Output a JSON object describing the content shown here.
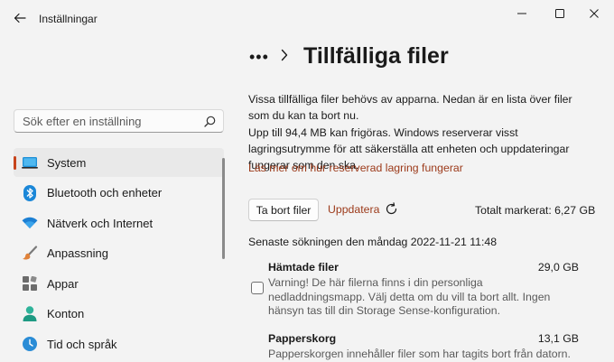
{
  "window": {
    "app_title": "Inställningar"
  },
  "search": {
    "placeholder": "Sök efter en inställning"
  },
  "sidebar": {
    "items": [
      {
        "label": "System",
        "icon": "laptop-icon",
        "active": true
      },
      {
        "label": "Bluetooth och enheter",
        "icon": "bluetooth-icon",
        "active": false
      },
      {
        "label": "Nätverk och Internet",
        "icon": "wifi-icon",
        "active": false
      },
      {
        "label": "Anpassning",
        "icon": "brush-icon",
        "active": false
      },
      {
        "label": "Appar",
        "icon": "apps-icon",
        "active": false
      },
      {
        "label": "Konton",
        "icon": "person-icon",
        "active": false
      },
      {
        "label": "Tid och språk",
        "icon": "clock-globe-icon",
        "active": false
      }
    ]
  },
  "breadcrumb": {
    "more": "•••"
  },
  "page": {
    "title": "Tillfälliga filer",
    "intro": "Vissa tillfälliga filer behövs av apparna. Nedan är en lista över filer som du kan ta bort nu.",
    "reserve_info": "Upp till 94,4 MB kan frigöras. Windows reserverar visst lagringsutrymme för att säkerställa att enheten och uppdateringar fungerar som den ska.",
    "learn_more_link": "Läs mer om hur reserverad lagring fungerar",
    "remove_button": "Ta bort filer",
    "refresh_button": "Uppdatera",
    "total_marked": "Totalt markerat: 6,27 GB",
    "last_scan": "Senaste sökningen den måndag 2022-11-21 11:48"
  },
  "files": [
    {
      "name": "Hämtade filer",
      "size": "29,0 GB",
      "description": "Varning! De här filerna finns i din personliga nedladdningsmapp. Välj detta om du vill ta bort allt. Ingen hänsyn tas till din Storage Sense-konfiguration.",
      "checked": false
    },
    {
      "name": "Papperskorg",
      "size": "13,1 GB",
      "description": "Papperskorgen innehåller filer som har tagits bort från datorn.",
      "checked": true
    }
  ],
  "colors": {
    "accent": "#c7441c",
    "link": "#9c3a1a",
    "background": "#f3f3f3"
  }
}
